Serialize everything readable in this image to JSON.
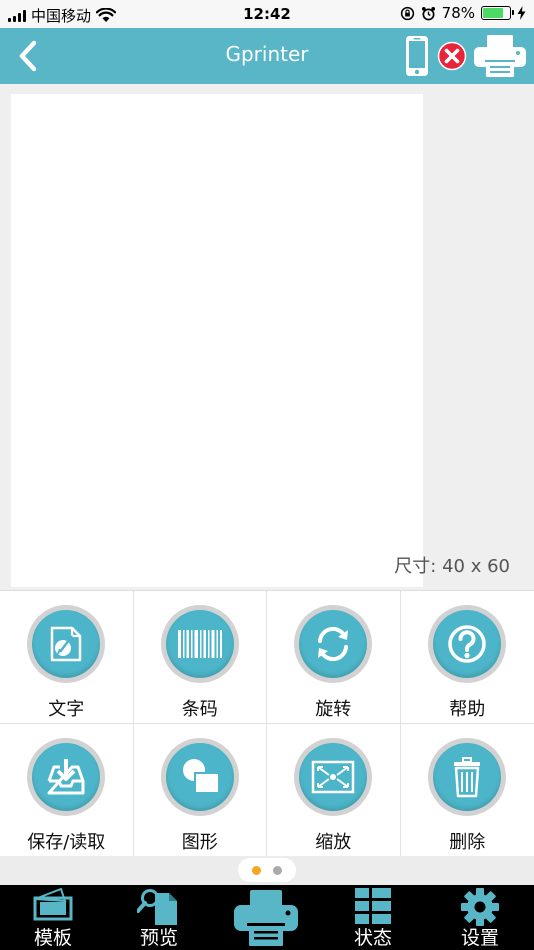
{
  "status_bar": {
    "carrier": "中国移动",
    "time": "12:42",
    "battery_percent": "78%",
    "battery_level": 0.78,
    "icons": [
      "signal-icon",
      "wifi-icon",
      "rotation-lock-icon",
      "alarm-icon",
      "battery-icon",
      "charging-icon"
    ]
  },
  "nav": {
    "title": "Gprinter",
    "icons": [
      "back-chevron-icon",
      "phone-icon",
      "disconnected-icon",
      "printer-icon"
    ]
  },
  "canvas": {
    "size_readout": "尺寸:  40 x 60"
  },
  "tools": [
    {
      "label": "文字",
      "icon": "text-edit-icon"
    },
    {
      "label": "条码",
      "icon": "barcode-icon"
    },
    {
      "label": "旋转",
      "icon": "rotate-icon"
    },
    {
      "label": "帮助",
      "icon": "help-icon"
    },
    {
      "label": "保存/读取",
      "icon": "save-load-icon"
    },
    {
      "label": "图形",
      "icon": "shapes-icon"
    },
    {
      "label": "缩放",
      "icon": "zoom-icon"
    },
    {
      "label": "删除",
      "icon": "trash-icon"
    }
  ],
  "pager": {
    "pages": 2,
    "active": 1
  },
  "tabs": [
    {
      "label": "模板",
      "icon": "template-icon"
    },
    {
      "label": "预览",
      "icon": "preview-icon"
    },
    {
      "label": "",
      "icon": "print-icon"
    },
    {
      "label": "状态",
      "icon": "status-icon"
    },
    {
      "label": "设置",
      "icon": "settings-gear-icon"
    }
  ],
  "colors": {
    "accent": "#58b6c6",
    "tool_disc": "#4db5c9",
    "pager_active": "#f5a623",
    "disconnected": "#e8253a",
    "tab_bar": "#000000"
  }
}
